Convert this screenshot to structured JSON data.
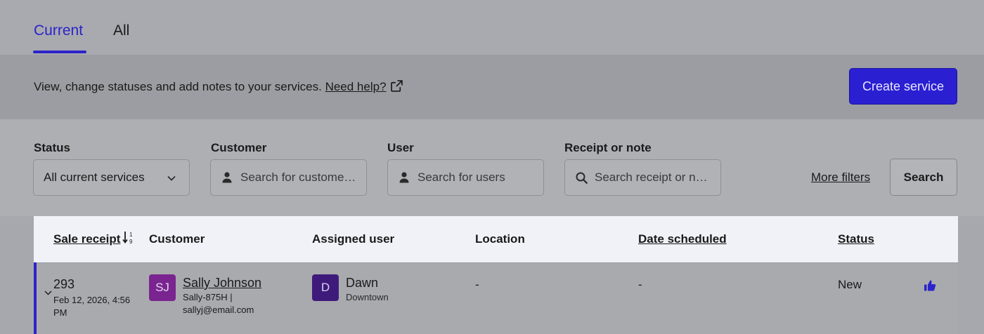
{
  "tabs": [
    {
      "label": "Current",
      "active": true
    },
    {
      "label": "All",
      "active": false
    }
  ],
  "banner": {
    "text": "View, change statuses and add notes to your services.",
    "help_link": "Need help?",
    "external_icon": "external-link-icon",
    "create_button": "Create service"
  },
  "filters": {
    "status": {
      "label": "Status",
      "value": "All current services"
    },
    "customer": {
      "label": "Customer",
      "placeholder": "Search for custome…"
    },
    "user": {
      "label": "User",
      "placeholder": "Search for users"
    },
    "receipt": {
      "label": "Receipt or note",
      "placeholder": "Search receipt or n…"
    },
    "more_filters": "More filters",
    "search_button": "Search"
  },
  "table": {
    "headers": {
      "sale_receipt": "Sale receipt",
      "customer": "Customer",
      "assigned_user": "Assigned user",
      "location": "Location",
      "date_scheduled": "Date scheduled",
      "status": "Status"
    },
    "sort_icon": "sort-ascending-icon",
    "rows": [
      {
        "receipt": "293",
        "date": "Feb 12, 2026, 4:56 PM",
        "customer_initials": "SJ",
        "customer_name": "Sally Johnson",
        "customer_line1": "Sally-875H |",
        "customer_line2": "sallyj@email.com",
        "user_initial": "D",
        "user_name": "Dawn",
        "user_location": "Downtown",
        "location": "-",
        "date_scheduled": "-",
        "status": "New"
      }
    ]
  },
  "colors": {
    "accent": "#2b23c9",
    "customer_avatar": "#7a2490",
    "user_avatar": "#3e1b7a"
  }
}
